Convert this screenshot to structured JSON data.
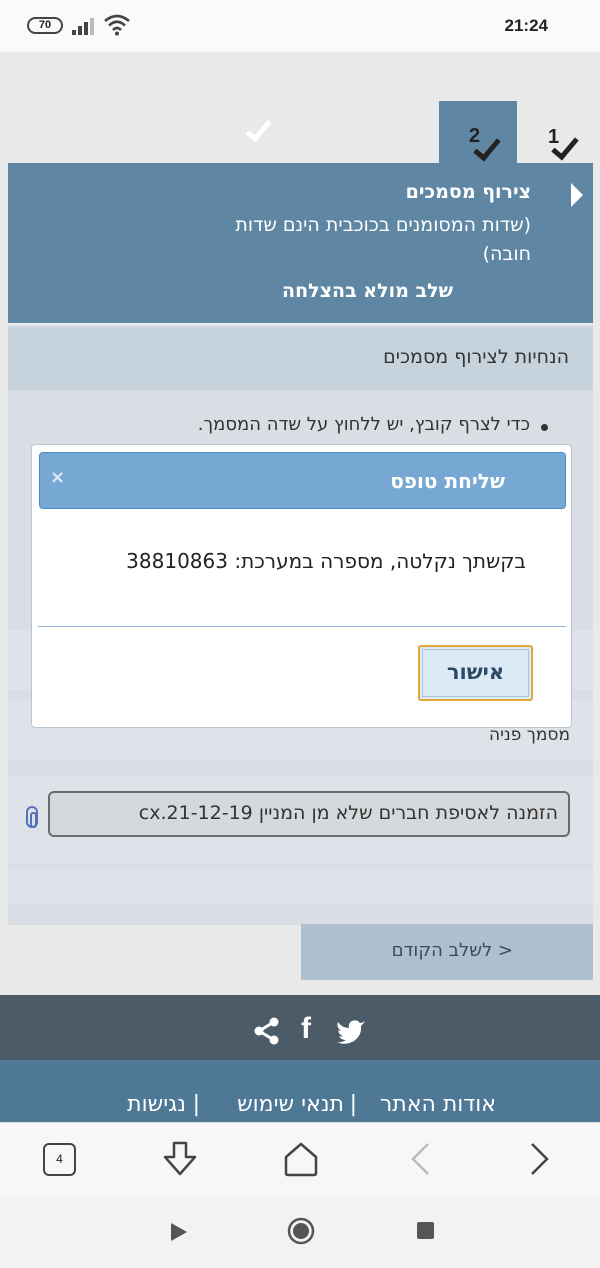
{
  "status_bar": {
    "battery": "70",
    "time": "21:24"
  },
  "steps": {
    "step1_number": "1",
    "step2_number": "2"
  },
  "stage": {
    "title": "צירוף מסמכים",
    "subtitle": "(שדות המסומנים בכוכבית הינם שדות חובה)",
    "completed_text": "שלב מולא בהצלחה"
  },
  "instructions": {
    "header": "הנחיות לצירוף מסמכים",
    "bullet": "כדי לצרף קובץ, יש ללחוץ על שדה המסמך."
  },
  "documents": {
    "label": "מסמך פניה",
    "file_name": "הזמנה לאסיפת חברים שלא מן המניין 19-cx.21-12"
  },
  "navigation": {
    "prev_button": "< לשלב הקודם"
  },
  "footer": {
    "links": [
      "אודות האתר",
      "תנאי שימוש",
      "נגישות"
    ],
    "separator": "|"
  },
  "browser": {
    "tabs_count": "4"
  },
  "modal": {
    "title": "שליחת טופס",
    "close": "×",
    "message": "בקשתך נקלטה, מספרה במערכת: 38810863",
    "ok_button": "אישור"
  }
}
